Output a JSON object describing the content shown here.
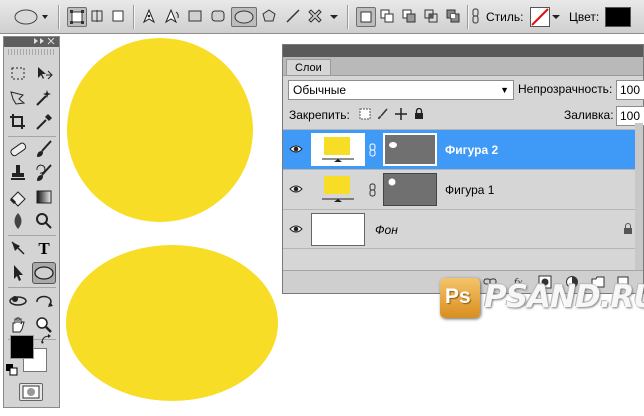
{
  "options_bar": {
    "style_label": "Стиль:",
    "color_label": "Цвет:",
    "color_swatch": "#000000"
  },
  "colors": {
    "shape_yellow": "#f7dd25",
    "selection_blue": "#3f9af7",
    "foreground": "#000000",
    "background": "#ffffff"
  },
  "tools": {
    "items": [
      "marquee-icon",
      "move-icon",
      "lasso-icon",
      "magic-wand-icon",
      "crop-icon",
      "eyedropper-icon",
      "healing-brush-icon",
      "brush-icon",
      "clone-stamp-icon",
      "history-brush-icon",
      "eraser-icon",
      "gradient-icon",
      "blur-icon",
      "dodge-icon",
      "pen-icon",
      "type-icon",
      "path-selection-icon",
      "ellipse-tool-icon",
      "rotate-view-icon",
      "3d-rotate-icon",
      "hand-icon",
      "zoom-icon"
    ],
    "type_glyph": "T"
  },
  "layers_panel": {
    "tab_label": "Слои",
    "blend_mode": "Обычные",
    "opacity_label": "Непрозрачность:",
    "opacity_value": "100",
    "lock_label": "Закрепить:",
    "fill_label": "Заливка:",
    "fill_value": "100",
    "layers": [
      {
        "name": "Фигура 2",
        "selected": true
      },
      {
        "name": "Фигура 1",
        "selected": false
      },
      {
        "name": "Фон",
        "selected": false
      }
    ],
    "footer_fx": "fx"
  },
  "watermark": {
    "badge": "Ps",
    "text": "PSAND.RU"
  }
}
